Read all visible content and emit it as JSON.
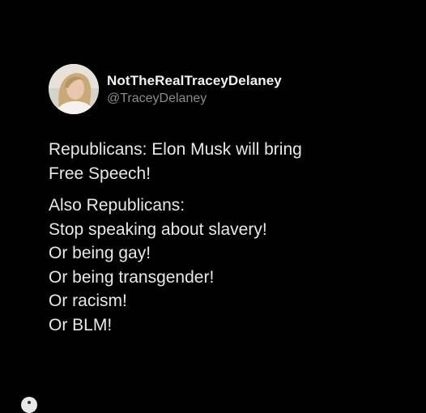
{
  "author": {
    "display_name": "NotTheRealTraceyDelaney",
    "handle": "@TraceyDelaney",
    "avatar_icon": "profile-photo"
  },
  "tweet": {
    "paragraph1": [
      "Republicans: Elon Musk will bring",
      "Free Speech!"
    ],
    "paragraph2": [
      "Also Republicans:",
      "Stop speaking about slavery!",
      "Or being gay!",
      "Or being transgender!",
      "Or racism!",
      "Or BLM!"
    ]
  },
  "colors": {
    "background": "#000000",
    "text": "#e8e8e8",
    "handle": "#8b8b8b"
  }
}
